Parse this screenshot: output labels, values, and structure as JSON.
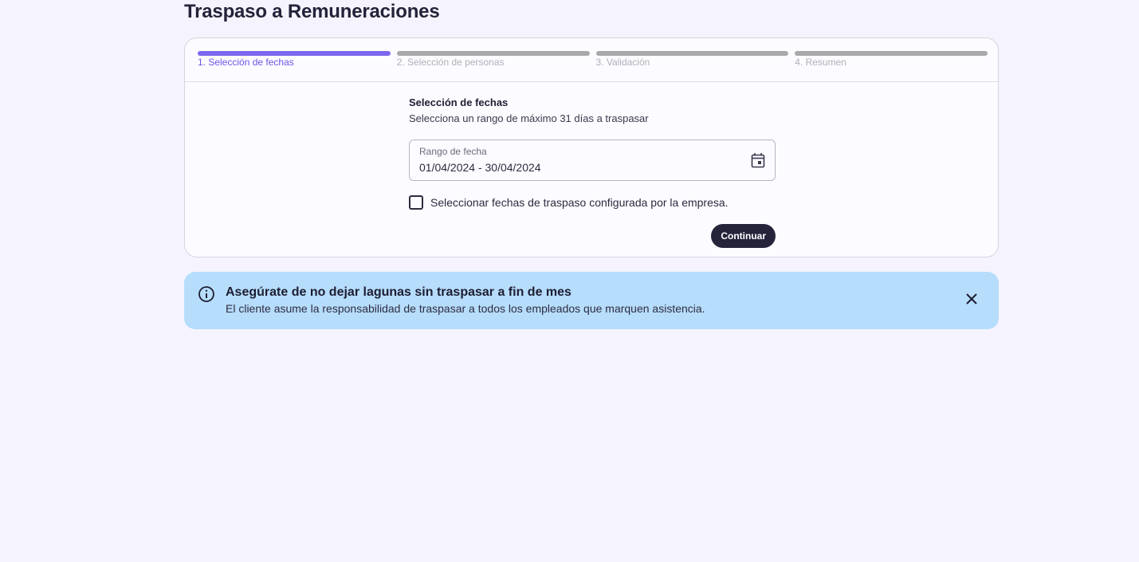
{
  "page": {
    "title": "Traspaso a Remuneraciones"
  },
  "stepper": {
    "steps": [
      {
        "label": "1. Selección de fechas",
        "active": true
      },
      {
        "label": "2. Selección de personas",
        "active": false
      },
      {
        "label": "3. Validación",
        "active": false
      },
      {
        "label": "4. Resumen",
        "active": false
      }
    ]
  },
  "form": {
    "section_title": "Selección de fechas",
    "section_subtitle": "Selecciona un rango de máximo 31 días a traspasar",
    "date_range": {
      "label": "Rango de fecha",
      "value": "01/04/2024 - 30/04/2024",
      "icon": "calendar-icon"
    },
    "checkbox": {
      "label": "Seleccionar fechas de traspaso configurada por la empresa.",
      "checked": false
    },
    "continue_label": "Continuar"
  },
  "alert": {
    "icon": "info-icon",
    "title": "Asegúrate de no dejar lagunas sin traspasar a fin de mes",
    "body": "El cliente asume la responsabilidad de traspasar a todos los empleados que marquen asistencia.",
    "close_icon": "close-icon"
  },
  "colors": {
    "background": "#f5f4fe",
    "accent": "#7b68ee",
    "step_inactive": "#a9a9ab",
    "button": "#25243b",
    "alert_bg": "#b6ddfb"
  }
}
